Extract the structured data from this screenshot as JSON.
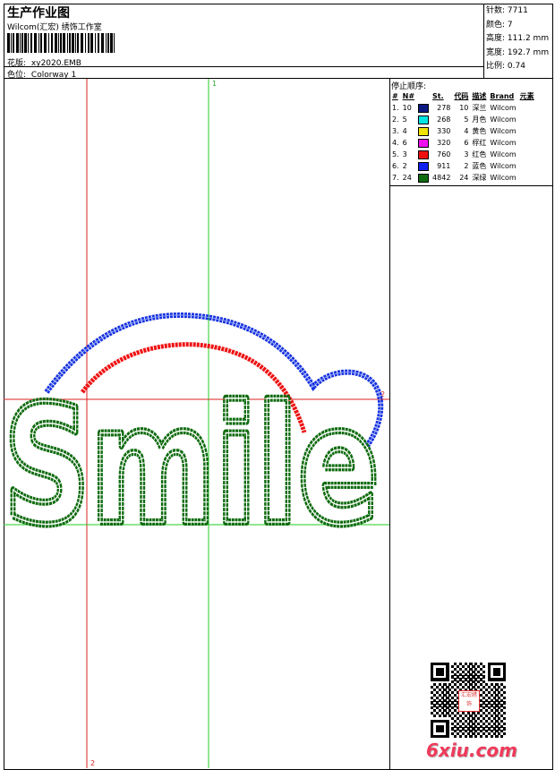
{
  "header": {
    "title": "生产作业图",
    "company": "Wilcom(汇宏) 绣饰工作室",
    "design_label": "花版:",
    "design_file": "xy2020.EMB",
    "colorway_label": "色位:",
    "colorway": "Colorway 1"
  },
  "stats": [
    {
      "label": "针数:",
      "value": "7711"
    },
    {
      "label": "颜色:",
      "value": "7"
    },
    {
      "label": "高度:",
      "value": "111.2 mm"
    },
    {
      "label": "宽度:",
      "value": "192.7 mm"
    },
    {
      "label": "比例:",
      "value": "0.74"
    }
  ],
  "stop_sequence": {
    "title": "停止顺序:",
    "columns": [
      "#",
      "N#",
      "St.",
      "代码",
      "描述",
      "Brand",
      "元素"
    ],
    "rows": [
      {
        "num": "1.",
        "n": "10",
        "color": "#0a1a80",
        "st": "278",
        "code": "10",
        "desc": "深兰",
        "brand": "Wilcom"
      },
      {
        "num": "2.",
        "n": "5",
        "color": "#00e5e5",
        "st": "268",
        "code": "5",
        "desc": "月色",
        "brand": "Wilcom"
      },
      {
        "num": "3.",
        "n": "4",
        "color": "#f2e400",
        "st": "330",
        "code": "4",
        "desc": "黄色",
        "brand": "Wilcom"
      },
      {
        "num": "4.",
        "n": "6",
        "color": "#ee10ee",
        "st": "320",
        "code": "6",
        "desc": "桴红",
        "brand": "Wilcom"
      },
      {
        "num": "5.",
        "n": "3",
        "color": "#ee1010",
        "st": "760",
        "code": "3",
        "desc": "红色",
        "brand": "Wilcom"
      },
      {
        "num": "6.",
        "n": "2",
        "color": "#1020ee",
        "st": "911",
        "code": "2",
        "desc": "蓝色",
        "brand": "Wilcom"
      },
      {
        "num": "7.",
        "n": "24",
        "color": "#0f6b0f",
        "st": "4842",
        "code": "24",
        "desc": "深绿",
        "brand": "Wilcom"
      }
    ]
  },
  "design": {
    "word": "Smile",
    "guide_labels": {
      "top": "1",
      "right": "2",
      "bottom": "2"
    },
    "colors": {
      "outline": "#0f6b0f",
      "arc_outer": "#1530e0",
      "arc_inner": "#ee1111",
      "guide_green": "#22cc22",
      "guide_red": "#dd2222"
    }
  },
  "watermark": {
    "text": "6xiu.com",
    "seal_text": "汇宏绣饰"
  }
}
